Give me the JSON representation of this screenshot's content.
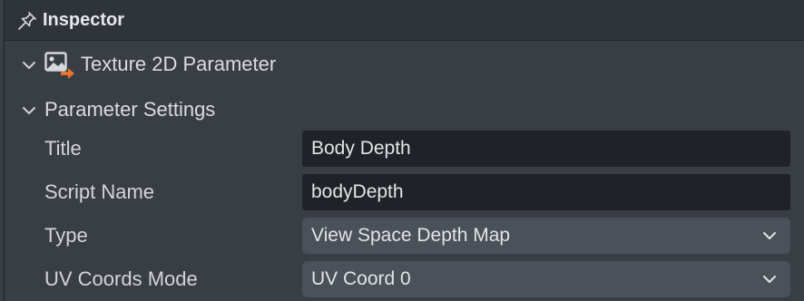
{
  "header": {
    "title": "Inspector",
    "icon": "pin-icon"
  },
  "component": {
    "title": "Texture 2D Parameter",
    "icon": "texture-image-icon",
    "accent": "#e8742c"
  },
  "section": {
    "title": "Parameter Settings"
  },
  "fields": {
    "title": {
      "label": "Title",
      "value": "Body Depth"
    },
    "script_name": {
      "label": "Script Name",
      "value": "bodyDepth"
    },
    "type": {
      "label": "Type",
      "value": "View Space Depth Map"
    },
    "uv_mode": {
      "label": "UV Coords Mode",
      "value": "UV Coord 0"
    }
  }
}
